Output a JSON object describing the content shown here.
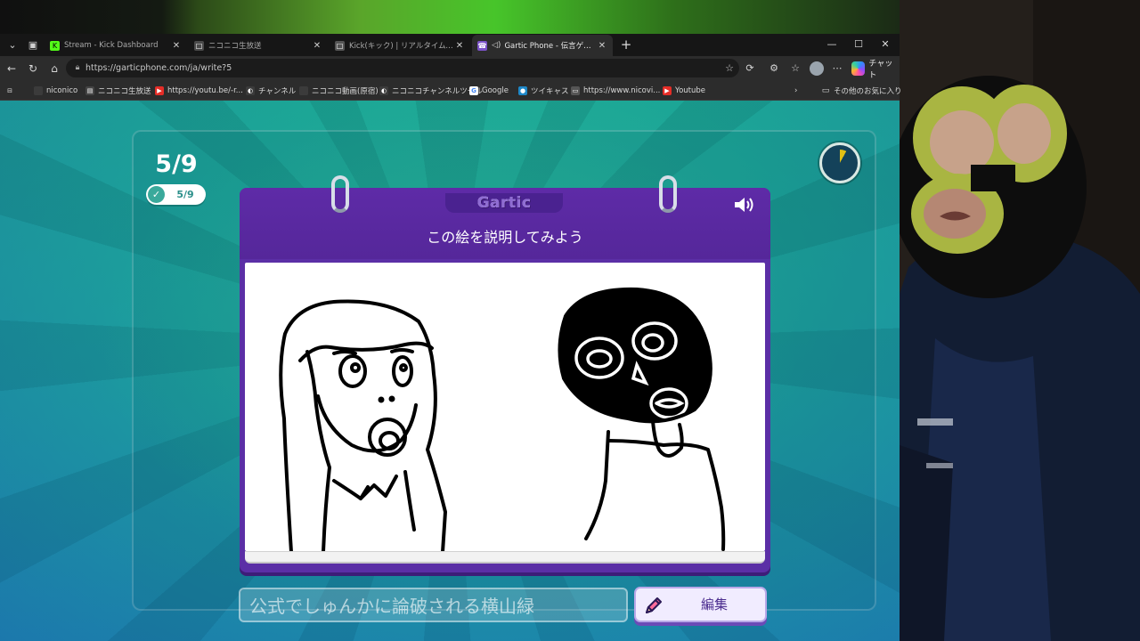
{
  "browser": {
    "tabs": [
      {
        "title": "Stream - Kick Dashboard",
        "icon": "kick-icon",
        "color": "#53fc18",
        "active": false
      },
      {
        "title": "ニコニコ生放送",
        "icon": "niconico-icon",
        "color": "#4a4a4a",
        "active": false
      },
      {
        "title": "Kick(キック) | リアルタイムランキング",
        "icon": "kick-ranking-icon",
        "color": "#555555",
        "active": false
      },
      {
        "title": "Gartic Phone - 伝言ゲーム",
        "icon": "gartic-icon",
        "color": "#7b52c7",
        "active": true
      }
    ],
    "url": "https://garticphone.com/ja/write?5",
    "chat_label": "チャット",
    "bookmarks": [
      {
        "label": "niconico",
        "icon": "niconico-icon",
        "color": "#3b3b3b"
      },
      {
        "label": "ニコニコ生放送",
        "icon": "niconico-live-icon",
        "color": "#444444"
      },
      {
        "label": "https://youtu.be/-r...",
        "icon": "youtube-icon",
        "color": "#e52d27"
      },
      {
        "label": "チャンネル",
        "icon": "channel-icon",
        "color": "#3b3b3b"
      },
      {
        "label": "ニコニコ動画(原宿)",
        "icon": "niconico-video-icon",
        "color": "#3b3b3b"
      },
      {
        "label": "ニコニコチャンネルツール",
        "icon": "channel-tool-icon",
        "color": "#3b3b3b"
      },
      {
        "label": "Google",
        "icon": "google-icon",
        "color": "#4285f4"
      },
      {
        "label": "ツイキャス",
        "icon": "twitcasting-icon",
        "color": "#1e88c8"
      },
      {
        "label": "https://www.nicovi...",
        "icon": "nicovideo-icon",
        "color": "#555555"
      },
      {
        "label": "Youtube",
        "icon": "youtube-icon",
        "color": "#e52d27"
      }
    ],
    "other_bookmarks": "その他のお気に入り"
  },
  "game": {
    "round_big": "5/9",
    "round_pill": "5/9",
    "timer_fraction_elapsed": 0.08,
    "logo": "Gartic",
    "prompt": "この絵を説明してみよう",
    "answer_value": "公式でしゅんかに論破される横山緑",
    "edit_button": "編集",
    "colors": {
      "card": "#5b2fa6",
      "timer_wedge": "#e3c114",
      "background_teal": "#2bb5a0",
      "background_blue": "#1e78a6"
    }
  }
}
